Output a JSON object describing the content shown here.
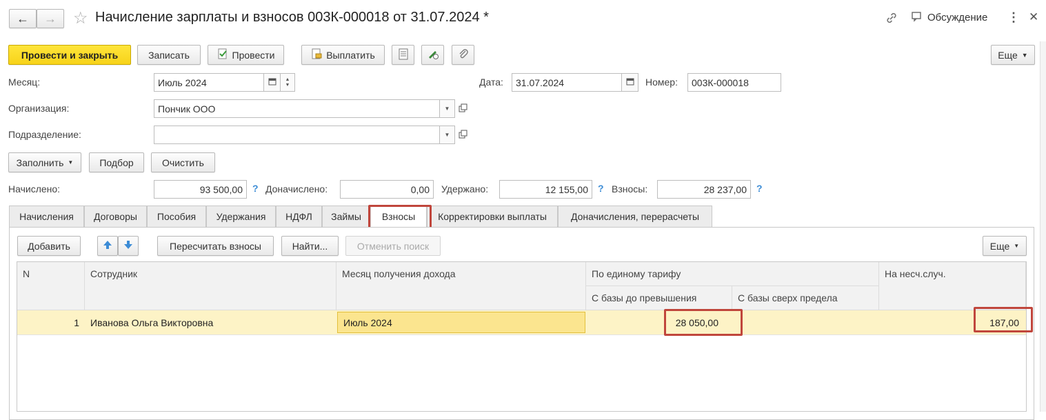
{
  "window": {
    "title": "Начисление зарплаты и взносов 003К-000018 от 31.07.2024 *",
    "discuss_label": "Обсуждение",
    "nav_back": "←",
    "nav_forward": "→",
    "star": "☆",
    "link_icon": "link-icon",
    "menu_icon": "⋮",
    "close_icon": "✕"
  },
  "toolbar": {
    "post_close": "Провести и закрыть",
    "save": "Записать",
    "post": "Провести",
    "pay": "Выплатить",
    "more": "Еще"
  },
  "form": {
    "month_label": "Месяц:",
    "month_value": "Июль 2024",
    "date_label": "Дата:",
    "date_value": "31.07.2024",
    "number_label": "Номер:",
    "number_value": "003К-000018",
    "org_label": "Организация:",
    "org_value": "Пончик ООО",
    "dept_label": "Подразделение:",
    "dept_value": ""
  },
  "actions": {
    "fill": "Заполнить",
    "pick": "Подбор",
    "clear": "Очистить"
  },
  "totals": {
    "accrued_label": "Начислено:",
    "accrued_value": "93 500,00",
    "extra_label": "Доначислено:",
    "extra_value": "0,00",
    "withheld_label": "Удержано:",
    "withheld_value": "12 155,00",
    "contrib_label": "Взносы:",
    "contrib_value": "28 237,00",
    "help": "?"
  },
  "tabs": [
    "Начисления",
    "Договоры",
    "Пособия",
    "Удержания",
    "НДФЛ",
    "Займы",
    "Взносы",
    "Корректировки выплаты",
    "Доначисления, перерасчеты"
  ],
  "active_tab": "Взносы",
  "table_toolbar": {
    "add": "Добавить",
    "recalc": "Пересчитать взносы",
    "find": "Найти...",
    "cancel_search": "Отменить поиск",
    "more": "Еще"
  },
  "table": {
    "headers": {
      "n": "N",
      "employee": "Сотрудник",
      "income_month": "Месяц получения дохода",
      "single_rate": "По единому тарифу",
      "base_below": "С базы до превышения",
      "base_above": "С базы сверх предела",
      "accident": "На несч.случ."
    },
    "rows": [
      {
        "n": "1",
        "employee": "Иванова Ольга Викторовна",
        "income_month": "Июль 2024",
        "base_below": "28 050,00",
        "base_above": "",
        "accident": "187,00"
      }
    ]
  },
  "colors": {
    "primary_button": "#f7d31a",
    "row_highlight": "#fdf3c6",
    "annotation_red": "#c0463c",
    "help_blue": "#3c8cd6"
  }
}
